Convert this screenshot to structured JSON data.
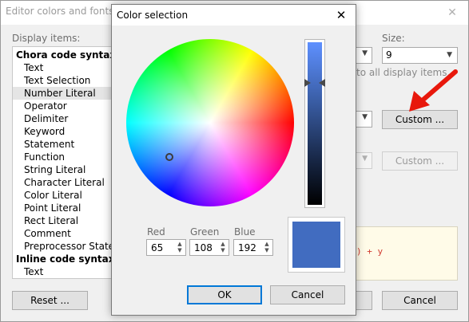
{
  "background_dialog": {
    "title": "Editor colors and fonts",
    "close_glyph": "✕",
    "display_items_label": "Display items:",
    "size_label": "Size:",
    "size_value": "9",
    "apply_all_text": "to all display items.",
    "custom_fg_label": "Custom ...",
    "custom_bg_label": "Custom ...",
    "reset_label": "Reset ...",
    "cancel_label": "Cancel",
    "preview_code": ") + y",
    "items": [
      {
        "label": "Chora code syntax elem",
        "kind": "group"
      },
      {
        "label": "Text",
        "kind": "child"
      },
      {
        "label": "Text Selection",
        "kind": "child"
      },
      {
        "label": "Number Literal",
        "kind": "child",
        "selected": true
      },
      {
        "label": "Operator",
        "kind": "child"
      },
      {
        "label": "Delimiter",
        "kind": "child"
      },
      {
        "label": "Keyword",
        "kind": "child"
      },
      {
        "label": "Statement",
        "kind": "child"
      },
      {
        "label": "Function",
        "kind": "child"
      },
      {
        "label": "String Literal",
        "kind": "child"
      },
      {
        "label": "Character Literal",
        "kind": "child"
      },
      {
        "label": "Color Literal",
        "kind": "child"
      },
      {
        "label": "Point Literal",
        "kind": "child"
      },
      {
        "label": "Rect Literal",
        "kind": "child"
      },
      {
        "label": "Comment",
        "kind": "child"
      },
      {
        "label": "Preprocessor Stateme",
        "kind": "child"
      },
      {
        "label": "Inline code syntax elen",
        "kind": "group"
      },
      {
        "label": "Text",
        "kind": "child"
      }
    ]
  },
  "color_dialog": {
    "title": "Color selection",
    "close_glyph": "✕",
    "red_label": "Red",
    "green_label": "Green",
    "blue_label": "Blue",
    "red_value": "65",
    "green_value": "108",
    "blue_value": "192",
    "selected_color": "#416cc0",
    "ok_label": "OK",
    "cancel_label": "Cancel"
  },
  "colors": {
    "accent_focus": "#0078d7",
    "annotation_arrow": "#e8180c",
    "preview_code_color": "#d23c32"
  }
}
